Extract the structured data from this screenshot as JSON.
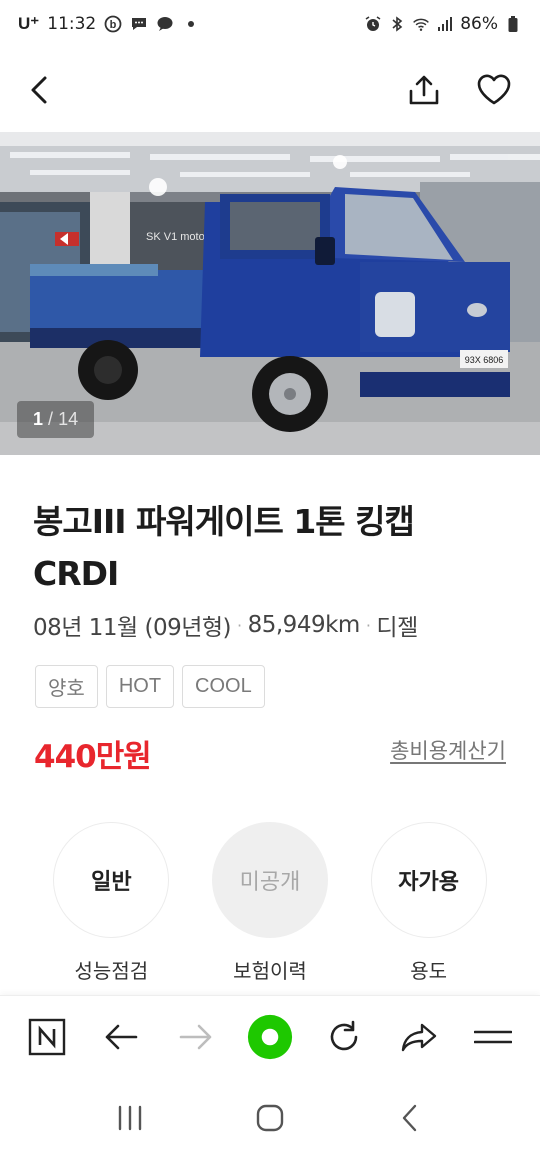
{
  "status_bar": {
    "carrier": "U⁺",
    "time": "11:32",
    "battery": "86%",
    "icons": [
      "b-icon",
      "chat-icon",
      "chat-bubble-icon",
      "dot-icon",
      "alarm-icon",
      "bluetooth-icon",
      "wifi-icon",
      "signal-icon",
      "battery-icon"
    ]
  },
  "header": {
    "back_icon": "back-arrow-icon",
    "share_icon": "share-icon",
    "favorite_icon": "heart-icon"
  },
  "photo": {
    "current": "1",
    "separator": "/",
    "total": "14",
    "plate_text": "93X 6806",
    "sign_text": "SK V1 motor"
  },
  "listing": {
    "title": "봉고III 파워게이트 1톤 킹캡 CRDI",
    "spec": {
      "date": "08년 11월 (09년형)",
      "mileage": "85,949km",
      "fuel": "디젤"
    },
    "tags": [
      "양호",
      "HOT",
      "COOL"
    ],
    "price": "440만원",
    "calc_link": "총비용계산기",
    "price_color": "#e8262d"
  },
  "info": [
    {
      "value": "일반",
      "label": "성능점검",
      "muted": false
    },
    {
      "value": "미공개",
      "label": "보험이력",
      "muted": true
    },
    {
      "value": "자가용",
      "label": "용도",
      "muted": false
    }
  ],
  "browser_bar": {
    "buttons": [
      "naver-n-icon",
      "back-arrow-icon",
      "forward-arrow-icon",
      "green-home-icon",
      "reload-icon",
      "share-arrow-icon",
      "menu-icon"
    ],
    "accent": "#1ec800"
  },
  "nav_bar": {
    "buttons": [
      "recent-apps-icon",
      "home-icon",
      "back-icon"
    ]
  }
}
